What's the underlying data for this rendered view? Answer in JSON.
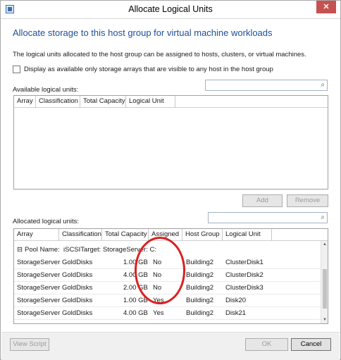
{
  "window": {
    "title": "Allocate Logical Units",
    "close_glyph": "✕"
  },
  "heading": "Allocate storage to this host group for virtual machine workloads",
  "description": "The logical units allocated to the host group can be assigned to hosts, clusters, or virtual machines.",
  "checkbox_label": "Display as available only storage arrays that are visible to any host in the host group",
  "available": {
    "label": "Available logical units:",
    "columns": [
      "Array",
      "Classification",
      "Total Capacity",
      "Logical Unit"
    ]
  },
  "buttons": {
    "add": "Add",
    "remove": "Remove",
    "view_script": "View Script",
    "ok": "OK",
    "cancel": "Cancel"
  },
  "allocated": {
    "label": "Allocated logical units:",
    "columns": [
      "Array",
      "Classification",
      "Total Capacity",
      "Assigned",
      "Host Group",
      "Logical Unit"
    ],
    "group": {
      "expander": "⊟",
      "label": "Pool Name:",
      "value": "iSCSITarget: StorageServer: C:"
    },
    "rows": [
      [
        "StorageServer",
        "GoldDisks",
        "1.00 GB",
        "No",
        "Building2",
        "ClusterDisk1"
      ],
      [
        "StorageServer",
        "GoldDisks",
        "4.00 GB",
        "No",
        "Building2",
        "ClusterDisk2"
      ],
      [
        "StorageServer",
        "GoldDisks",
        "2.00 GB",
        "No",
        "Building2",
        "ClusterDisk3"
      ],
      [
        "StorageServer",
        "GoldDisks",
        "1.00 GB",
        "Yes",
        "Building2",
        "Disk20"
      ],
      [
        "StorageServer",
        "GoldDisks",
        "4.00 GB",
        "Yes",
        "Building2",
        "Disk21"
      ]
    ]
  },
  "colors": {
    "heading": "#1e4e9c",
    "close": "#c75050",
    "annotation_circle": "#d92020"
  },
  "icons": {
    "search": "search-icon",
    "close": "close-icon",
    "app": "app-icon"
  }
}
